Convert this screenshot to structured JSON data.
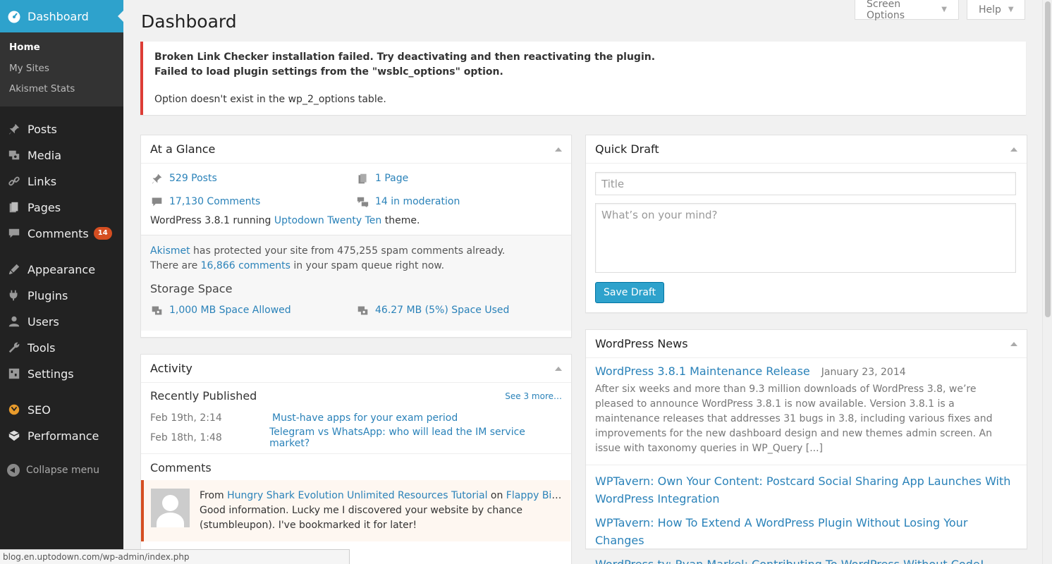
{
  "sidebar": {
    "dashboard_label": "Dashboard",
    "submenu": [
      "Home",
      "My Sites",
      "Akismet Stats"
    ],
    "items": [
      {
        "label": "Posts",
        "icon": "pin-icon"
      },
      {
        "label": "Media",
        "icon": "media-icon"
      },
      {
        "label": "Links",
        "icon": "link-icon"
      },
      {
        "label": "Pages",
        "icon": "pages-icon"
      },
      {
        "label": "Comments",
        "icon": "comment-icon",
        "badge": "14"
      },
      {
        "label": "Appearance",
        "icon": "brush-icon"
      },
      {
        "label": "Plugins",
        "icon": "plug-icon"
      },
      {
        "label": "Users",
        "icon": "user-icon"
      },
      {
        "label": "Tools",
        "icon": "wrench-icon"
      },
      {
        "label": "Settings",
        "icon": "settings-icon"
      },
      {
        "label": "SEO",
        "icon": "seo-icon"
      },
      {
        "label": "Performance",
        "icon": "performance-icon"
      }
    ],
    "collapse_label": "Collapse menu"
  },
  "header": {
    "title": "Dashboard",
    "screen_options": "Screen Options",
    "help": "Help"
  },
  "notice": {
    "line1": "Broken Link Checker installation failed. Try deactivating and then reactivating the plugin.",
    "line2": "Failed to load plugin settings from the \"wsblc_options\" option.",
    "line3": "Option doesn't exist in the wp_2_options table."
  },
  "glance": {
    "title": "At a Glance",
    "posts": "529 Posts",
    "pages": "1 Page",
    "comments": "17,130 Comments",
    "moderation": "14 in moderation",
    "version_prefix": "WordPress 3.8.1 running ",
    "theme": "Uptodown Twenty Ten",
    "version_suffix": " theme.",
    "akismet_link": "Akismet",
    "akismet_text": " has protected your site from 475,255 spam comments already.",
    "spam_prefix": "There are ",
    "spam_link": "16,866 comments",
    "spam_suffix": " in your spam queue right now.",
    "storage_title": "Storage Space",
    "space_allowed": "1,000 MB Space Allowed",
    "space_used": "46.27 MB (5%) Space Used"
  },
  "activity": {
    "title": "Activity",
    "recently_published": "Recently Published",
    "see_more": "See 3 more…",
    "posts": [
      {
        "date": "Feb 19th, 2:14",
        "title": "Must-have apps for your exam period"
      },
      {
        "date": "Feb 18th, 1:48",
        "title": "Telegram vs WhatsApp: who will lead the IM service market?"
      }
    ],
    "comments_title": "Comments",
    "comment": {
      "from": "From ",
      "author": "Hungry Shark Evolution Unlimited Resources Tutorial",
      "on": " on ",
      "post": "Flappy Bird, th...",
      "text": "Good information. Lucky me I discovered your website by chance (stumbleupon). I've bookmarked it for later!"
    }
  },
  "quickdraft": {
    "title": "Quick Draft",
    "title_placeholder": "Title",
    "content_placeholder": "What’s on your mind?",
    "save_label": "Save Draft"
  },
  "news": {
    "title": "WordPress News",
    "main_title": "WordPress 3.8.1 Maintenance Release",
    "main_date": "January 23, 2014",
    "main_excerpt": "After six weeks and more than 9.3 million downloads of WordPress 3.8, we’re pleased to announce WordPress 3.8.1 is now available. Version 3.8.1 is a maintenance releases that addresses 31 bugs in 3.8, including various fixes and improvements for the new dashboard design and new themes admin screen. An issue with taxonomy queries in WP_Query [...]",
    "links": [
      "WPTavern: Own Your Content: Postcard Social Sharing App Launches With WordPress Integration",
      "WPTavern: How To Extend A WordPress Plugin Without Losing Your Changes",
      "WordPress.tv: Ryan Markel: Contributing To WordPress Without Code!"
    ]
  },
  "statusbar": {
    "url": "blog.en.uptodown.com/wp-admin/index.php"
  },
  "colors": {
    "accent": "#2ea2cc",
    "sidebar_bg": "#222222",
    "notice_error": "#dd3d36",
    "badge": "#d54e21"
  }
}
